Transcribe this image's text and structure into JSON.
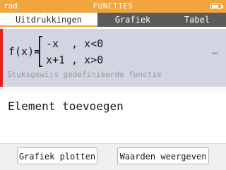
{
  "status_bar": {
    "mode": "rad",
    "title": "FUNCTIES",
    "battery_level": 0.75,
    "accent_color": "#f0a53e"
  },
  "tabs": [
    {
      "label": "Uitdrukkingen",
      "active": true
    },
    {
      "label": "Grafiek",
      "active": false
    },
    {
      "label": "Tabel",
      "active": false
    }
  ],
  "function": {
    "name": "f(x)=",
    "cases": [
      "-x  , x<0",
      "x+1 , x>0"
    ],
    "description": "Stuksgewijs gedefinieerde functie",
    "marker_color": "#e6201e",
    "options_glyph": "⋯"
  },
  "add_element_label": "Element toevoegen",
  "buttons": {
    "plot_label": "Grafiek plotten",
    "values_label": "Waarden weergeven"
  }
}
